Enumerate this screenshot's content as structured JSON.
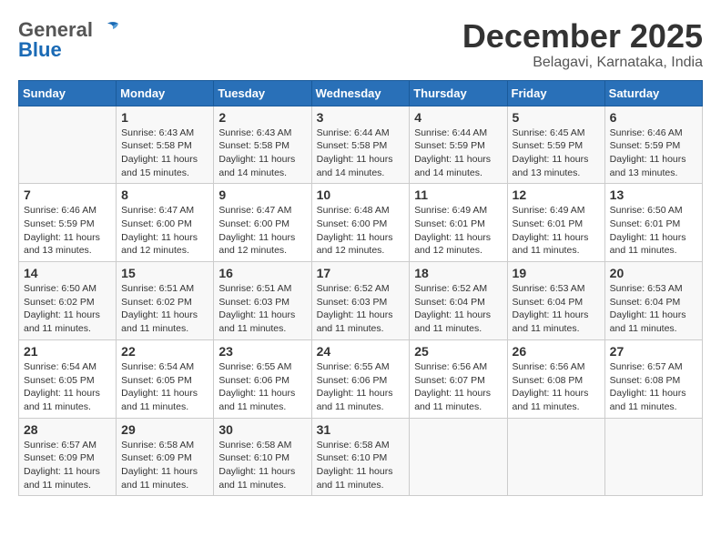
{
  "header": {
    "logo_general": "General",
    "logo_blue": "Blue",
    "month_title": "December 2025",
    "location": "Belagavi, Karnataka, India"
  },
  "columns": [
    "Sunday",
    "Monday",
    "Tuesday",
    "Wednesday",
    "Thursday",
    "Friday",
    "Saturday"
  ],
  "weeks": [
    [
      {
        "day": "",
        "sunrise": "",
        "sunset": "",
        "daylight": ""
      },
      {
        "day": "1",
        "sunrise": "Sunrise: 6:43 AM",
        "sunset": "Sunset: 5:58 PM",
        "daylight": "Daylight: 11 hours and 15 minutes."
      },
      {
        "day": "2",
        "sunrise": "Sunrise: 6:43 AM",
        "sunset": "Sunset: 5:58 PM",
        "daylight": "Daylight: 11 hours and 14 minutes."
      },
      {
        "day": "3",
        "sunrise": "Sunrise: 6:44 AM",
        "sunset": "Sunset: 5:58 PM",
        "daylight": "Daylight: 11 hours and 14 minutes."
      },
      {
        "day": "4",
        "sunrise": "Sunrise: 6:44 AM",
        "sunset": "Sunset: 5:59 PM",
        "daylight": "Daylight: 11 hours and 14 minutes."
      },
      {
        "day": "5",
        "sunrise": "Sunrise: 6:45 AM",
        "sunset": "Sunset: 5:59 PM",
        "daylight": "Daylight: 11 hours and 13 minutes."
      },
      {
        "day": "6",
        "sunrise": "Sunrise: 6:46 AM",
        "sunset": "Sunset: 5:59 PM",
        "daylight": "Daylight: 11 hours and 13 minutes."
      }
    ],
    [
      {
        "day": "7",
        "sunrise": "Sunrise: 6:46 AM",
        "sunset": "Sunset: 5:59 PM",
        "daylight": "Daylight: 11 hours and 13 minutes."
      },
      {
        "day": "8",
        "sunrise": "Sunrise: 6:47 AM",
        "sunset": "Sunset: 6:00 PM",
        "daylight": "Daylight: 11 hours and 12 minutes."
      },
      {
        "day": "9",
        "sunrise": "Sunrise: 6:47 AM",
        "sunset": "Sunset: 6:00 PM",
        "daylight": "Daylight: 11 hours and 12 minutes."
      },
      {
        "day": "10",
        "sunrise": "Sunrise: 6:48 AM",
        "sunset": "Sunset: 6:00 PM",
        "daylight": "Daylight: 11 hours and 12 minutes."
      },
      {
        "day": "11",
        "sunrise": "Sunrise: 6:49 AM",
        "sunset": "Sunset: 6:01 PM",
        "daylight": "Daylight: 11 hours and 12 minutes."
      },
      {
        "day": "12",
        "sunrise": "Sunrise: 6:49 AM",
        "sunset": "Sunset: 6:01 PM",
        "daylight": "Daylight: 11 hours and 11 minutes."
      },
      {
        "day": "13",
        "sunrise": "Sunrise: 6:50 AM",
        "sunset": "Sunset: 6:01 PM",
        "daylight": "Daylight: 11 hours and 11 minutes."
      }
    ],
    [
      {
        "day": "14",
        "sunrise": "Sunrise: 6:50 AM",
        "sunset": "Sunset: 6:02 PM",
        "daylight": "Daylight: 11 hours and 11 minutes."
      },
      {
        "day": "15",
        "sunrise": "Sunrise: 6:51 AM",
        "sunset": "Sunset: 6:02 PM",
        "daylight": "Daylight: 11 hours and 11 minutes."
      },
      {
        "day": "16",
        "sunrise": "Sunrise: 6:51 AM",
        "sunset": "Sunset: 6:03 PM",
        "daylight": "Daylight: 11 hours and 11 minutes."
      },
      {
        "day": "17",
        "sunrise": "Sunrise: 6:52 AM",
        "sunset": "Sunset: 6:03 PM",
        "daylight": "Daylight: 11 hours and 11 minutes."
      },
      {
        "day": "18",
        "sunrise": "Sunrise: 6:52 AM",
        "sunset": "Sunset: 6:04 PM",
        "daylight": "Daylight: 11 hours and 11 minutes."
      },
      {
        "day": "19",
        "sunrise": "Sunrise: 6:53 AM",
        "sunset": "Sunset: 6:04 PM",
        "daylight": "Daylight: 11 hours and 11 minutes."
      },
      {
        "day": "20",
        "sunrise": "Sunrise: 6:53 AM",
        "sunset": "Sunset: 6:04 PM",
        "daylight": "Daylight: 11 hours and 11 minutes."
      }
    ],
    [
      {
        "day": "21",
        "sunrise": "Sunrise: 6:54 AM",
        "sunset": "Sunset: 6:05 PM",
        "daylight": "Daylight: 11 hours and 11 minutes."
      },
      {
        "day": "22",
        "sunrise": "Sunrise: 6:54 AM",
        "sunset": "Sunset: 6:05 PM",
        "daylight": "Daylight: 11 hours and 11 minutes."
      },
      {
        "day": "23",
        "sunrise": "Sunrise: 6:55 AM",
        "sunset": "Sunset: 6:06 PM",
        "daylight": "Daylight: 11 hours and 11 minutes."
      },
      {
        "day": "24",
        "sunrise": "Sunrise: 6:55 AM",
        "sunset": "Sunset: 6:06 PM",
        "daylight": "Daylight: 11 hours and 11 minutes."
      },
      {
        "day": "25",
        "sunrise": "Sunrise: 6:56 AM",
        "sunset": "Sunset: 6:07 PM",
        "daylight": "Daylight: 11 hours and 11 minutes."
      },
      {
        "day": "26",
        "sunrise": "Sunrise: 6:56 AM",
        "sunset": "Sunset: 6:08 PM",
        "daylight": "Daylight: 11 hours and 11 minutes."
      },
      {
        "day": "27",
        "sunrise": "Sunrise: 6:57 AM",
        "sunset": "Sunset: 6:08 PM",
        "daylight": "Daylight: 11 hours and 11 minutes."
      }
    ],
    [
      {
        "day": "28",
        "sunrise": "Sunrise: 6:57 AM",
        "sunset": "Sunset: 6:09 PM",
        "daylight": "Daylight: 11 hours and 11 minutes."
      },
      {
        "day": "29",
        "sunrise": "Sunrise: 6:58 AM",
        "sunset": "Sunset: 6:09 PM",
        "daylight": "Daylight: 11 hours and 11 minutes."
      },
      {
        "day": "30",
        "sunrise": "Sunrise: 6:58 AM",
        "sunset": "Sunset: 6:10 PM",
        "daylight": "Daylight: 11 hours and 11 minutes."
      },
      {
        "day": "31",
        "sunrise": "Sunrise: 6:58 AM",
        "sunset": "Sunset: 6:10 PM",
        "daylight": "Daylight: 11 hours and 11 minutes."
      },
      {
        "day": "",
        "sunrise": "",
        "sunset": "",
        "daylight": ""
      },
      {
        "day": "",
        "sunrise": "",
        "sunset": "",
        "daylight": ""
      },
      {
        "day": "",
        "sunrise": "",
        "sunset": "",
        "daylight": ""
      }
    ]
  ]
}
